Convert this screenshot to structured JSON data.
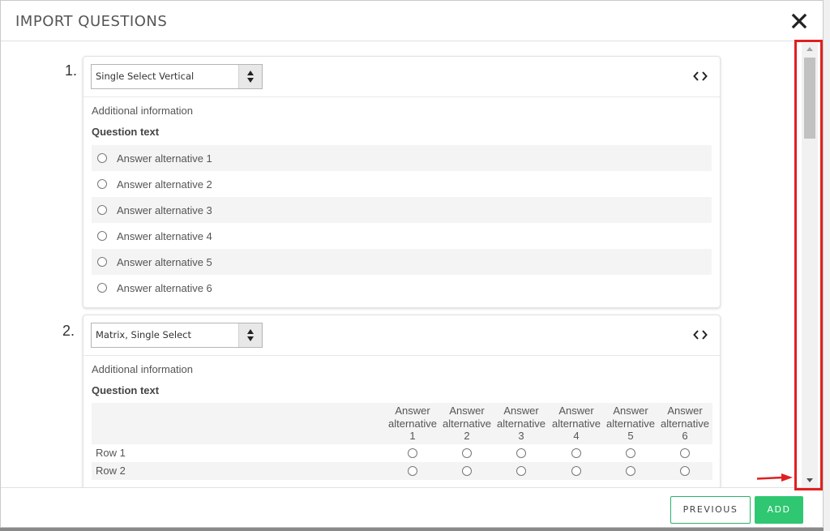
{
  "modal": {
    "title": "IMPORT QUESTIONS",
    "close_icon": "close-icon"
  },
  "questions": [
    {
      "number": "1.",
      "type": "Single Select Vertical",
      "additional_info": "Additional information",
      "question_text": "Question text",
      "answers": [
        "Answer alternative 1",
        "Answer alternative 2",
        "Answer alternative 3",
        "Answer alternative 4",
        "Answer alternative 5",
        "Answer alternative 6"
      ]
    },
    {
      "number": "2.",
      "type": "Matrix, Single Select",
      "additional_info": "Additional information",
      "question_text": "Question text",
      "columns": [
        [
          "Answer",
          "alternative",
          "1"
        ],
        [
          "Answer",
          "alternative",
          "2"
        ],
        [
          "Answer",
          "alternative",
          "3"
        ],
        [
          "Answer",
          "alternative",
          "4"
        ],
        [
          "Answer",
          "alternative",
          "5"
        ],
        [
          "Answer",
          "alternative",
          "6"
        ]
      ],
      "rows": [
        "Row 1",
        "Row 2"
      ]
    }
  ],
  "footer": {
    "previous_label": "PREVIOUS",
    "add_label": "ADD"
  },
  "colors": {
    "accent": "#2fc772",
    "highlight": "#e02020"
  },
  "icons": [
    "close-icon",
    "select-arrows-icon",
    "code-icon",
    "scroll-up-icon",
    "scroll-down-icon",
    "red-arrow-icon"
  ]
}
